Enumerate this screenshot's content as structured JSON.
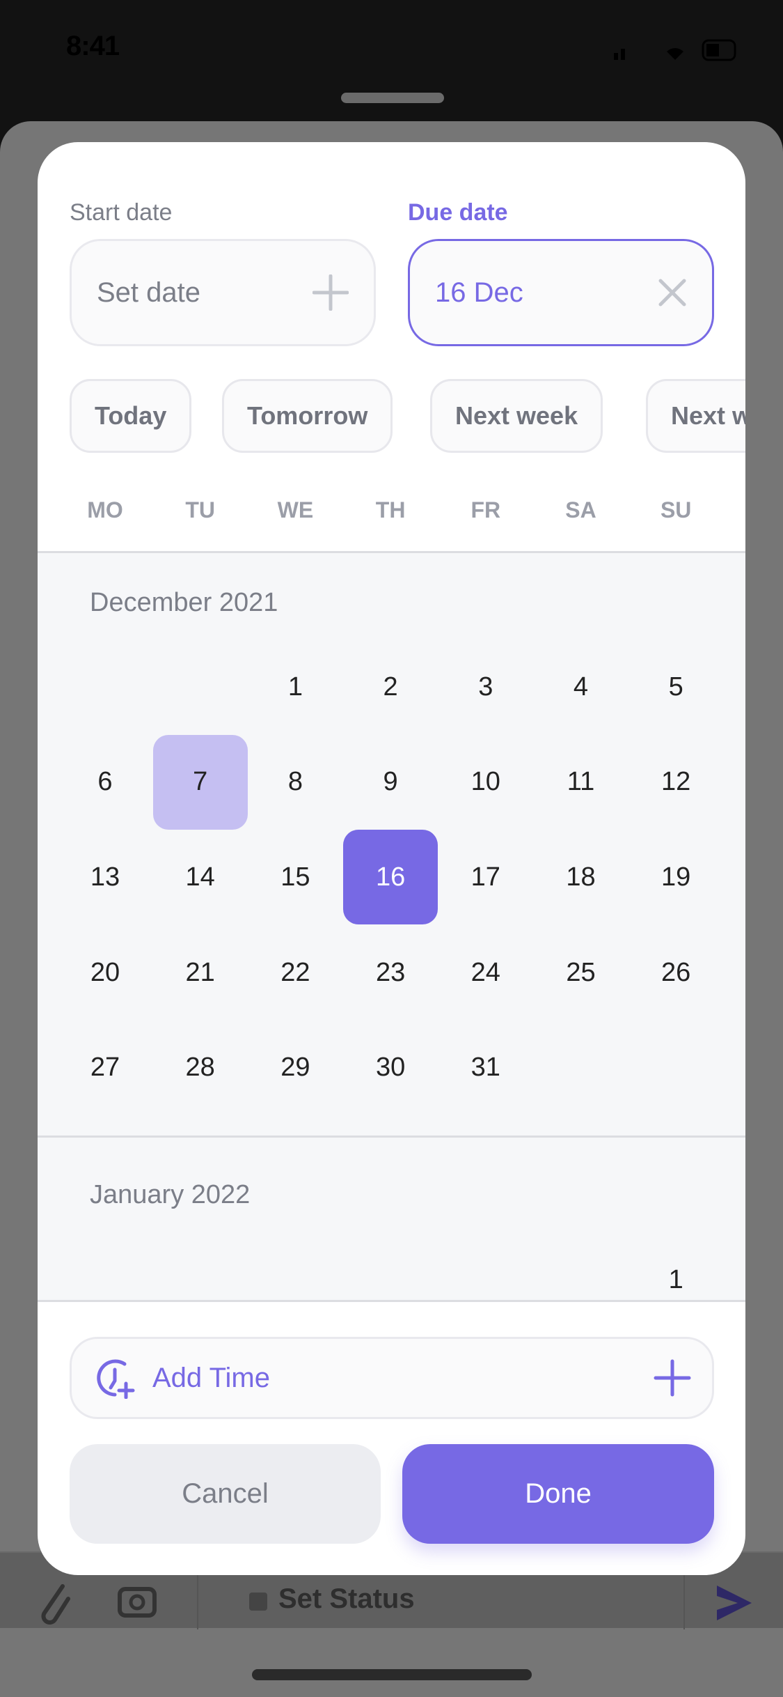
{
  "status_bar": {
    "time": "8:41"
  },
  "background": {
    "status_label": "Set Status"
  },
  "picker": {
    "start_label": "Start date",
    "due_label": "Due date",
    "start_placeholder": "Set date",
    "due_value": "16 Dec",
    "chips": [
      "Today",
      "Tomorrow",
      "Next week",
      "Next w"
    ],
    "weekdays": [
      "MO",
      "TU",
      "WE",
      "TH",
      "FR",
      "SA",
      "SU"
    ],
    "months": [
      {
        "title": "December 2021",
        "first_weekday_index": 2,
        "days": 31,
        "today": 7,
        "selected": 16
      },
      {
        "title": "January 2022",
        "first_weekday_index": 5,
        "days_shown": 2
      }
    ],
    "add_time_label": "Add Time",
    "cancel_label": "Cancel",
    "done_label": "Done"
  },
  "colors": {
    "accent": "#7769e4",
    "today_bg": "#c5bff2",
    "calendar_bg": "#f6f7f9"
  }
}
